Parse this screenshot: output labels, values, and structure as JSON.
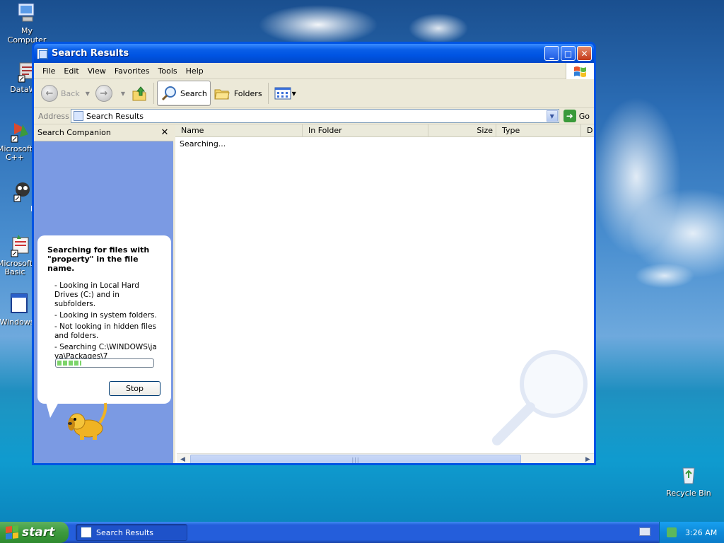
{
  "desktop": {
    "icons": [
      {
        "label": "My Computer"
      },
      {
        "label": "DataWar"
      },
      {
        "label": "Microsoft C++"
      },
      {
        "label": "Myp"
      },
      {
        "label": "Microsoft Basic"
      },
      {
        "label": "Windows"
      },
      {
        "label": "Recycle Bin"
      }
    ]
  },
  "window": {
    "title": "Search Results",
    "controls": {
      "minimize": "_",
      "maximize": "□",
      "close": "✕"
    },
    "menu": [
      "File",
      "Edit",
      "View",
      "Favorites",
      "Tools",
      "Help"
    ],
    "toolbar": {
      "back": "Back",
      "search": "Search",
      "folders": "Folders"
    },
    "address": {
      "label": "Address",
      "value": "Search Results",
      "go": "Go"
    }
  },
  "companion": {
    "title": "Search Companion",
    "close": "✕",
    "heading": "Searching for files with \"property\" in the file name.",
    "status_items": [
      "- Looking in Local Hard Drives (C:) and in subfolders.",
      "- Looking in system folders.",
      "- Not looking in hidden files and folders.",
      "- Searching C:\\WINDOWS\\java\\Packages\\7"
    ],
    "stop_button": "Stop",
    "progress_fraction": 0.25
  },
  "results": {
    "columns": [
      "Name",
      "In Folder",
      "Size",
      "Type",
      "D"
    ],
    "status": "Searching..."
  },
  "taskbar": {
    "start": "start",
    "task": "Search Results",
    "clock": "3:26 AM"
  },
  "colors": {
    "title_blue": "#0054e3",
    "companion_bg": "#7b9ae3",
    "start_green": "#3c9a3c",
    "taskbar_blue": "#245edb"
  }
}
